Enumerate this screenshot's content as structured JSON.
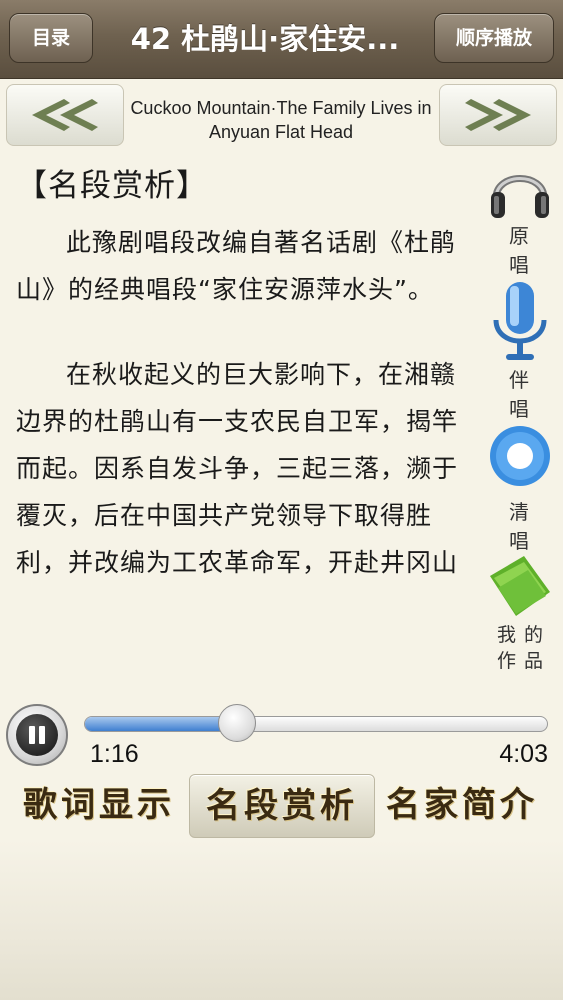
{
  "header": {
    "back_label": "目录",
    "title": "42 杜鹃山·家住安...",
    "play_mode_label": "顺序播放"
  },
  "nav": {
    "subtitle": "Cuckoo Mountain·The Family Lives in Anyuan Flat Head"
  },
  "content": {
    "heading": "【名段赏析】",
    "paragraphs": [
      "此豫剧唱段改编自著名话剧《杜鹃山》的经典唱段“家住安源萍水头”。",
      "在秋收起义的巨大影响下，在湘赣边界的杜鹃山有一支农民自卫军，揭竿而起。因系自发斗争，三起三落，濒于覆灭，后在中国共产党领导下取得胜利，并改编为工农革命军，开赴井冈山"
    ]
  },
  "side_tools": {
    "original": "原 唱",
    "accompaniment": "伴 唱",
    "clear": "清 唱",
    "my_works_line1": "我的",
    "my_works_line2": "作品"
  },
  "player": {
    "current_time": "1:16",
    "total_time": "4:03",
    "progress_fraction": 0.3128
  },
  "tabs": {
    "lyrics": "歌词显示",
    "analysis": "名段赏析",
    "artists": "名家简介",
    "active": "analysis"
  },
  "colors": {
    "accent_blue": "#3f7fd0",
    "title_bar": "#6f6250",
    "background": "#f6f3e7",
    "green_folder": "#7bc63b"
  },
  "icons": [
    "back-arrows-icon",
    "forward-arrows-icon",
    "headphones-icon",
    "microphone-icon",
    "vinyl-record-icon",
    "folder-icon",
    "pause-icon"
  ]
}
